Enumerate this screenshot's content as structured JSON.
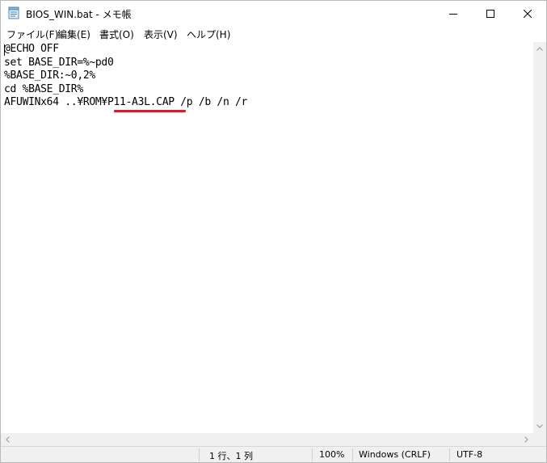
{
  "window": {
    "title": "BIOS_WIN.bat - メモ帳",
    "buttons": {
      "minimize": "minimize-icon",
      "maximize": "maximize-icon",
      "close": "close-icon"
    }
  },
  "menu": {
    "items": [
      {
        "label": "ファイル(F)"
      },
      {
        "label": "編集(E)"
      },
      {
        "label": "書式(O)"
      },
      {
        "label": "表示(V)"
      },
      {
        "label": "ヘルプ(H)"
      }
    ]
  },
  "editor": {
    "lines": [
      "@ECHO OFF",
      "set BASE_DIR=%~pd0",
      "%BASE_DIR:~0,2%",
      "cd %BASE_DIR%",
      "AFUWINx64 ..¥ROM¥P11-A3L.CAP /p /b /n /r"
    ],
    "highlight_color": "#d0202c"
  },
  "status": {
    "position": "1 行、1 列",
    "zoom": "100%",
    "line_ending": "Windows (CRLF)",
    "encoding": "UTF-8"
  }
}
